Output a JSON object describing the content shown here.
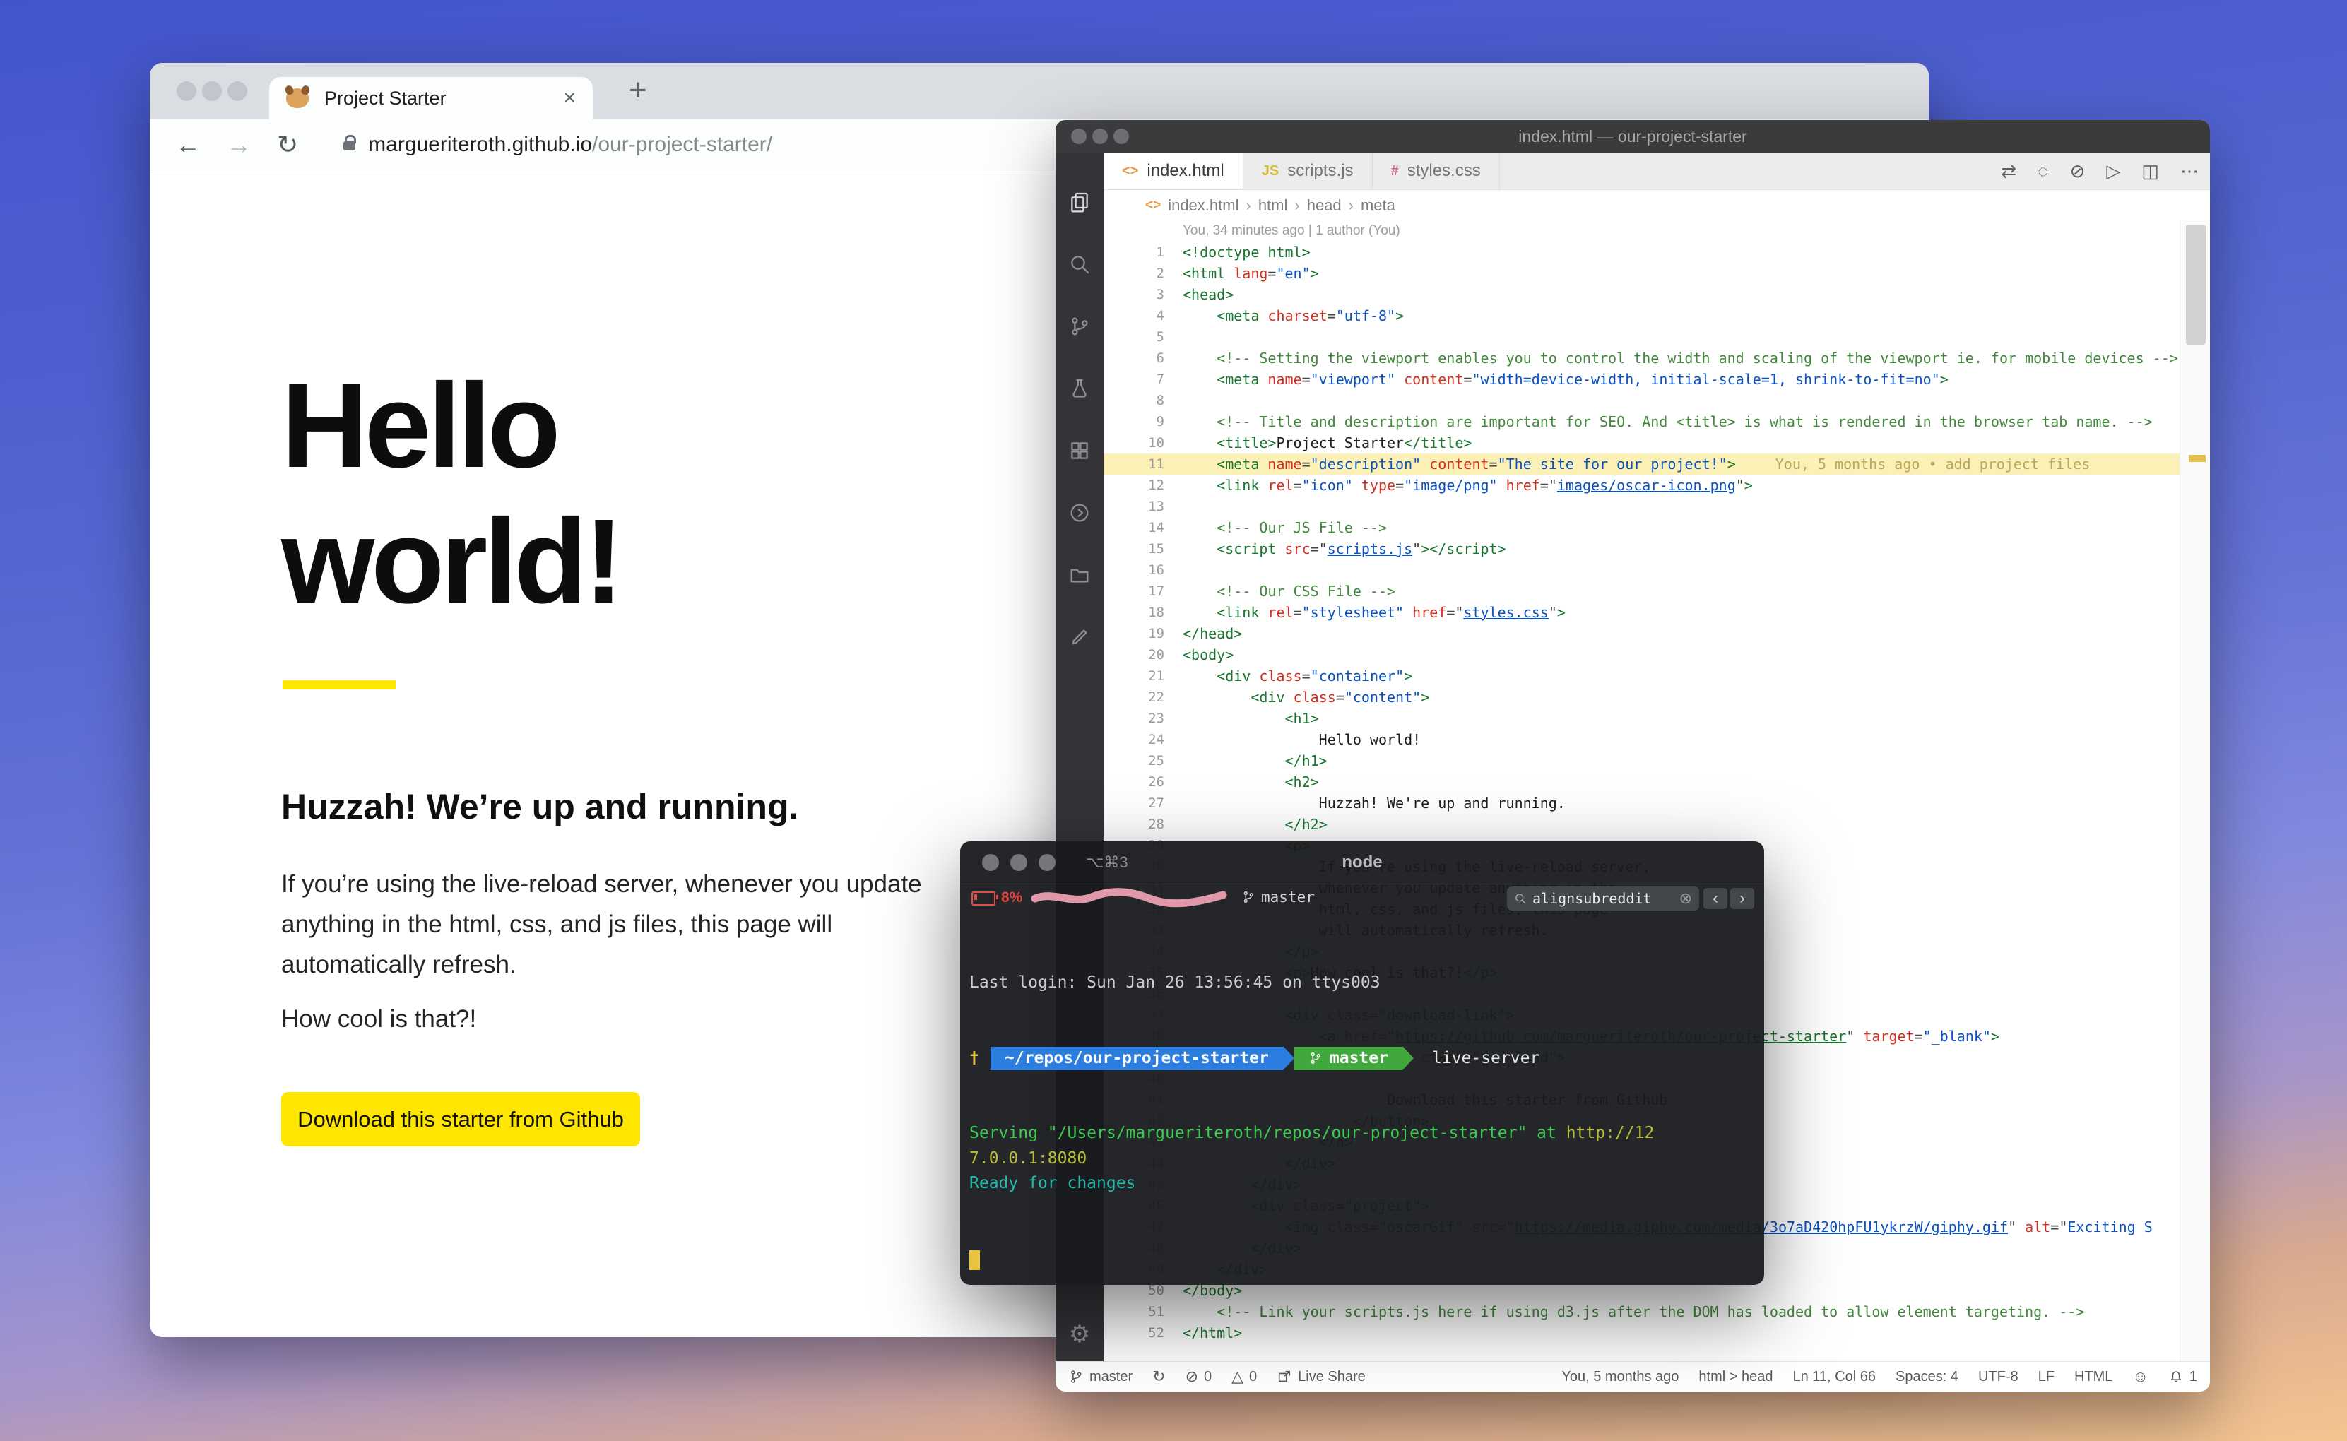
{
  "browser": {
    "tab_title": "Project Starter",
    "tab_close": "×",
    "new_tab": "+",
    "back": "←",
    "forward": "→",
    "reload": "↻",
    "url_host": "margueriteroth.github.io",
    "url_path": "/our-project-starter/",
    "page": {
      "heading_lines": [
        "Hello",
        "world!"
      ],
      "subheading": "Huzzah! We’re up and running.",
      "body_lines": [
        "If you’re using the live-reload server, whenever you update",
        "anything in the html, css, and js files, this page will",
        "automatically refresh."
      ],
      "closing_line": "How cool is that?!",
      "button_label": "Download this starter from Github",
      "accent_color": "#ffe600"
    }
  },
  "vscode": {
    "window_title": "index.html — our-project-starter",
    "activity_icons": [
      "files-icon",
      "search-icon",
      "source-control-icon",
      "beaker-icon",
      "extensions-icon",
      "live-share-icon",
      "folder-icon",
      "edit-icon"
    ],
    "gear": "⚙",
    "tabs": [
      {
        "label": "index.html",
        "glyph": "<>",
        "color": "#e8994a",
        "active": true
      },
      {
        "label": "scripts.js",
        "glyph": "JS",
        "color": "#d6ba32",
        "active": false
      },
      {
        "label": "styles.css",
        "glyph": "#",
        "color": "#c76494",
        "active": false
      }
    ],
    "editor_actions": [
      "⇄",
      "◌",
      "⊘",
      "▷",
      "◫",
      "⋯"
    ],
    "breadcrumb": [
      "index.html",
      "html",
      "head",
      "meta"
    ],
    "codelens": "You, 34 minutes ago | 1 author (You)",
    "code_lines": [
      {
        "n": 1,
        "i": 0,
        "s": [
          {
            "t": "<!doctype html>",
            "c": "g"
          }
        ]
      },
      {
        "n": 2,
        "i": 0,
        "s": [
          {
            "t": "<html ",
            "c": "g"
          },
          {
            "t": "lang",
            "c": "a"
          },
          {
            "t": "=",
            "c": "p"
          },
          {
            "t": "\"en\"",
            "c": "s"
          },
          {
            "t": ">",
            "c": "g"
          }
        ]
      },
      {
        "n": 3,
        "i": 0,
        "s": [
          {
            "t": "<head>",
            "c": "g"
          }
        ]
      },
      {
        "n": 4,
        "i": 4,
        "s": [
          {
            "t": "<meta ",
            "c": "g"
          },
          {
            "t": "charset",
            "c": "a"
          },
          {
            "t": "=",
            "c": "p"
          },
          {
            "t": "\"utf-8\"",
            "c": "s"
          },
          {
            "t": ">",
            "c": "g"
          }
        ]
      },
      {
        "n": 5,
        "i": 0,
        "s": []
      },
      {
        "n": 6,
        "i": 4,
        "s": [
          {
            "t": "<!-- Setting the viewport enables you to control the width and scaling of the viewport ie. for mobile devices -->",
            "c": "c"
          }
        ]
      },
      {
        "n": 7,
        "i": 4,
        "s": [
          {
            "t": "<meta ",
            "c": "g"
          },
          {
            "t": "name",
            "c": "a"
          },
          {
            "t": "=",
            "c": "p"
          },
          {
            "t": "\"viewport\"",
            "c": "s"
          },
          {
            "t": " ",
            "c": "p"
          },
          {
            "t": "content",
            "c": "a"
          },
          {
            "t": "=",
            "c": "p"
          },
          {
            "t": "\"width=device-width, initial-scale=1, shrink-to-fit=no\"",
            "c": "s"
          },
          {
            "t": ">",
            "c": "g"
          }
        ]
      },
      {
        "n": 8,
        "i": 0,
        "s": []
      },
      {
        "n": 9,
        "i": 4,
        "s": [
          {
            "t": "<!-- Title and description are important for SEO. And <title> is what is rendered in the browser tab name. -->",
            "c": "c"
          }
        ]
      },
      {
        "n": 10,
        "i": 4,
        "s": [
          {
            "t": "<title>",
            "c": "g"
          },
          {
            "t": "Project Starter",
            "c": "t"
          },
          {
            "t": "</title>",
            "c": "g"
          }
        ]
      },
      {
        "n": 11,
        "i": 4,
        "hl": true,
        "b": "You, 5 months ago • add project files",
        "s": [
          {
            "t": "<meta ",
            "c": "g"
          },
          {
            "t": "name",
            "c": "a"
          },
          {
            "t": "=",
            "c": "p"
          },
          {
            "t": "\"description\"",
            "c": "s"
          },
          {
            "t": " ",
            "c": "p"
          },
          {
            "t": "content",
            "c": "a"
          },
          {
            "t": "=",
            "c": "p"
          },
          {
            "t": "\"The site for our project!\"",
            "c": "s"
          },
          {
            "t": ">",
            "c": "g"
          }
        ]
      },
      {
        "n": 12,
        "i": 4,
        "s": [
          {
            "t": "<link ",
            "c": "g"
          },
          {
            "t": "rel",
            "c": "a"
          },
          {
            "t": "=",
            "c": "p"
          },
          {
            "t": "\"icon\"",
            "c": "s"
          },
          {
            "t": " ",
            "c": "p"
          },
          {
            "t": "type",
            "c": "a"
          },
          {
            "t": "=",
            "c": "p"
          },
          {
            "t": "\"image/png\"",
            "c": "s"
          },
          {
            "t": " ",
            "c": "p"
          },
          {
            "t": "href",
            "c": "a"
          },
          {
            "t": "=\"",
            "c": "p"
          },
          {
            "t": "images/oscar-icon.png",
            "c": "l"
          },
          {
            "t": "\"",
            "c": "p"
          },
          {
            "t": ">",
            "c": "g"
          }
        ]
      },
      {
        "n": 13,
        "i": 0,
        "s": []
      },
      {
        "n": 14,
        "i": 4,
        "s": [
          {
            "t": "<!-- Our JS File -->",
            "c": "c"
          }
        ]
      },
      {
        "n": 15,
        "i": 4,
        "s": [
          {
            "t": "<script ",
            "c": "g"
          },
          {
            "t": "src",
            "c": "a"
          },
          {
            "t": "=\"",
            "c": "p"
          },
          {
            "t": "scripts.js",
            "c": "l"
          },
          {
            "t": "\"",
            "c": "p"
          },
          {
            "t": "></script>",
            "c": "g"
          }
        ]
      },
      {
        "n": 16,
        "i": 0,
        "s": []
      },
      {
        "n": 17,
        "i": 4,
        "s": [
          {
            "t": "<!-- Our CSS File -->",
            "c": "c"
          }
        ]
      },
      {
        "n": 18,
        "i": 4,
        "s": [
          {
            "t": "<link ",
            "c": "g"
          },
          {
            "t": "rel",
            "c": "a"
          },
          {
            "t": "=",
            "c": "p"
          },
          {
            "t": "\"stylesheet\"",
            "c": "s"
          },
          {
            "t": " ",
            "c": "p"
          },
          {
            "t": "href",
            "c": "a"
          },
          {
            "t": "=\"",
            "c": "p"
          },
          {
            "t": "styles.css",
            "c": "l"
          },
          {
            "t": "\"",
            "c": "p"
          },
          {
            "t": ">",
            "c": "g"
          }
        ]
      },
      {
        "n": 19,
        "i": 0,
        "s": [
          {
            "t": "</head>",
            "c": "g"
          }
        ]
      },
      {
        "n": 20,
        "i": 0,
        "s": [
          {
            "t": "<body>",
            "c": "g"
          }
        ]
      },
      {
        "n": 21,
        "i": 4,
        "s": [
          {
            "t": "<div ",
            "c": "g"
          },
          {
            "t": "class",
            "c": "a"
          },
          {
            "t": "=",
            "c": "p"
          },
          {
            "t": "\"container\"",
            "c": "s"
          },
          {
            "t": ">",
            "c": "g"
          }
        ]
      },
      {
        "n": 22,
        "i": 8,
        "s": [
          {
            "t": "<div ",
            "c": "g"
          },
          {
            "t": "class",
            "c": "a"
          },
          {
            "t": "=",
            "c": "p"
          },
          {
            "t": "\"content\"",
            "c": "s"
          },
          {
            "t": ">",
            "c": "g"
          }
        ]
      },
      {
        "n": 23,
        "i": 12,
        "s": [
          {
            "t": "<h1>",
            "c": "g"
          }
        ]
      },
      {
        "n": 24,
        "i": 16,
        "s": [
          {
            "t": "Hello world!",
            "c": "t"
          }
        ]
      },
      {
        "n": 25,
        "i": 12,
        "s": [
          {
            "t": "</h1>",
            "c": "g"
          }
        ]
      },
      {
        "n": 26,
        "i": 12,
        "s": [
          {
            "t": "<h2>",
            "c": "g"
          }
        ]
      },
      {
        "n": 27,
        "i": 16,
        "s": [
          {
            "t": "Huzzah! We're up and running.",
            "c": "t"
          }
        ]
      },
      {
        "n": 28,
        "i": 12,
        "s": [
          {
            "t": "</h2>",
            "c": "g"
          }
        ]
      },
      {
        "n": 29,
        "i": 12,
        "s": [
          {
            "t": "<p>",
            "c": "g"
          }
        ]
      },
      {
        "n": 30,
        "i": 16,
        "s": [
          {
            "t": "If you're using the live-reload server,",
            "c": "t"
          }
        ]
      },
      {
        "n": 31,
        "i": 16,
        "s": [
          {
            "t": "whenever you update anything in the",
            "c": "t"
          }
        ]
      },
      {
        "n": 32,
        "i": 16,
        "s": [
          {
            "t": "html, css, and js files, this page",
            "c": "t"
          }
        ]
      },
      {
        "n": 33,
        "i": 16,
        "s": [
          {
            "t": "will automatically refresh.",
            "c": "t"
          }
        ]
      },
      {
        "n": 34,
        "i": 12,
        "s": [
          {
            "t": "</p>",
            "c": "g"
          }
        ]
      },
      {
        "n": 35,
        "i": 12,
        "s": [
          {
            "t": "<p>",
            "c": "g"
          },
          {
            "t": "How cool is that?!",
            "c": "t"
          },
          {
            "t": "</p>",
            "c": "g"
          }
        ]
      },
      {
        "n": 36,
        "i": 0,
        "s": []
      },
      {
        "n": 37,
        "i": 12,
        "s": [
          {
            "t": "<div ",
            "c": "g"
          },
          {
            "t": "class",
            "c": "a"
          },
          {
            "t": "=",
            "c": "p"
          },
          {
            "t": "\"download-link\"",
            "c": "s"
          },
          {
            "t": ">",
            "c": "g"
          }
        ]
      },
      {
        "n": 38,
        "i": 16,
        "s": [
          {
            "t": "<a ",
            "c": "g"
          },
          {
            "t": "href",
            "c": "a"
          },
          {
            "t": "=\"",
            "c": "p"
          },
          {
            "t": "https://github.com/margueriteroth/our-project-starter",
            "c": "L"
          },
          {
            "t": "\"",
            "c": "p"
          },
          {
            "t": " ",
            "c": "p"
          },
          {
            "t": "target",
            "c": "a"
          },
          {
            "t": "=",
            "c": "p"
          },
          {
            "t": "\"_blank\"",
            "c": "s"
          },
          {
            "t": ">",
            "c": "g"
          }
        ]
      },
      {
        "n": 39,
        "i": 20,
        "s": [
          {
            "t": "<button ",
            "c": "g"
          },
          {
            "t": "class",
            "c": "a"
          },
          {
            "t": "=",
            "c": "p"
          },
          {
            "t": "\"download\"",
            "c": "s"
          },
          {
            "t": ">",
            "c": "g"
          }
        ]
      },
      {
        "n": 40,
        "i": 0,
        "s": []
      },
      {
        "n": 41,
        "i": 24,
        "s": [
          {
            "t": "Download this starter from Github",
            "c": "t"
          }
        ]
      },
      {
        "n": 42,
        "i": 20,
        "s": [
          {
            "t": "</button>",
            "c": "g"
          }
        ]
      },
      {
        "n": 43,
        "i": 16,
        "s": [
          {
            "t": "</a>",
            "c": "g"
          }
        ]
      },
      {
        "n": 44,
        "i": 12,
        "s": [
          {
            "t": "</div>",
            "c": "g"
          }
        ]
      },
      {
        "n": 45,
        "i": 8,
        "s": [
          {
            "t": "</div>",
            "c": "g"
          }
        ]
      },
      {
        "n": 46,
        "i": 8,
        "s": [
          {
            "t": "<div ",
            "c": "g"
          },
          {
            "t": "class",
            "c": "a"
          },
          {
            "t": "=",
            "c": "p"
          },
          {
            "t": "\"project\"",
            "c": "s"
          },
          {
            "t": ">",
            "c": "g"
          }
        ]
      },
      {
        "n": 47,
        "i": 12,
        "s": [
          {
            "t": "<img ",
            "c": "g"
          },
          {
            "t": "class",
            "c": "a"
          },
          {
            "t": "=",
            "c": "p"
          },
          {
            "t": "\"oscarGif\"",
            "c": "s"
          },
          {
            "t": " ",
            "c": "p"
          },
          {
            "t": "src",
            "c": "a"
          },
          {
            "t": "=\"",
            "c": "p"
          },
          {
            "t": "https://media.giphy.com/media/3o7aD420hpFU1ykrzW/giphy.gif",
            "c": "l"
          },
          {
            "t": "\"",
            "c": "p"
          },
          {
            "t": " ",
            "c": "p"
          },
          {
            "t": "alt",
            "c": "a"
          },
          {
            "t": "=\"",
            "c": "p"
          },
          {
            "t": "Exciting S",
            "c": "s"
          }
        ]
      },
      {
        "n": 48,
        "i": 8,
        "s": [
          {
            "t": "</div>",
            "c": "g"
          }
        ]
      },
      {
        "n": 49,
        "i": 4,
        "s": [
          {
            "t": "</div>",
            "c": "g"
          }
        ]
      },
      {
        "n": 50,
        "i": 0,
        "s": [
          {
            "t": "</body>",
            "c": "g"
          }
        ]
      },
      {
        "n": 51,
        "i": 4,
        "s": [
          {
            "t": "<!-- Link your scripts.js here if using d3.js after the DOM has loaded to allow element targeting. -->",
            "c": "c"
          }
        ]
      },
      {
        "n": 52,
        "i": 0,
        "s": [
          {
            "t": "</html>",
            "c": "g"
          }
        ]
      }
    ],
    "status_left": [
      {
        "icon": "branch-icon",
        "label": "master"
      },
      {
        "icon": "sync-icon",
        "label": ""
      },
      {
        "icon": "error-icon",
        "label": "0"
      },
      {
        "icon": "warning-icon",
        "label": "0"
      },
      {
        "icon": "share-icon",
        "label": "Live Share"
      }
    ],
    "status_right": [
      {
        "label": "You, 5 months ago"
      },
      {
        "label": "html > head"
      },
      {
        "label": "Ln 11, Col 66"
      },
      {
        "label": "Spaces: 4"
      },
      {
        "label": "UTF-8"
      },
      {
        "label": "LF"
      },
      {
        "label": "HTML"
      },
      {
        "icon": "smiley-icon",
        "label": ""
      },
      {
        "icon": "bell-icon",
        "label": "1"
      }
    ]
  },
  "terminal": {
    "shortcut": "⌥⌘3",
    "title": "node",
    "battery": "8%",
    "branch": "master",
    "search_text": "alignsubreddit",
    "search_close": "⊗",
    "nav_prev": "‹",
    "nav_next": "›",
    "login_line": "Last login: Sun Jan 26 13:56:45 on ttys003",
    "prompt": {
      "marker": "†",
      "path": "~/repos/our-project-starter",
      "branch": "master",
      "command": "live-server"
    },
    "output": [
      {
        "parts": [
          {
            "t": "Serving \"/Users/margueriteroth/repos/our-project-starter\" at ",
            "c": "tg"
          },
          {
            "t": "http://12",
            "c": "ty"
          }
        ]
      },
      {
        "parts": [
          {
            "t": "7.0.0.1:8080",
            "c": "ty"
          }
        ]
      },
      {
        "parts": [
          {
            "t": "Ready for changes",
            "c": "tc"
          }
        ]
      }
    ]
  }
}
